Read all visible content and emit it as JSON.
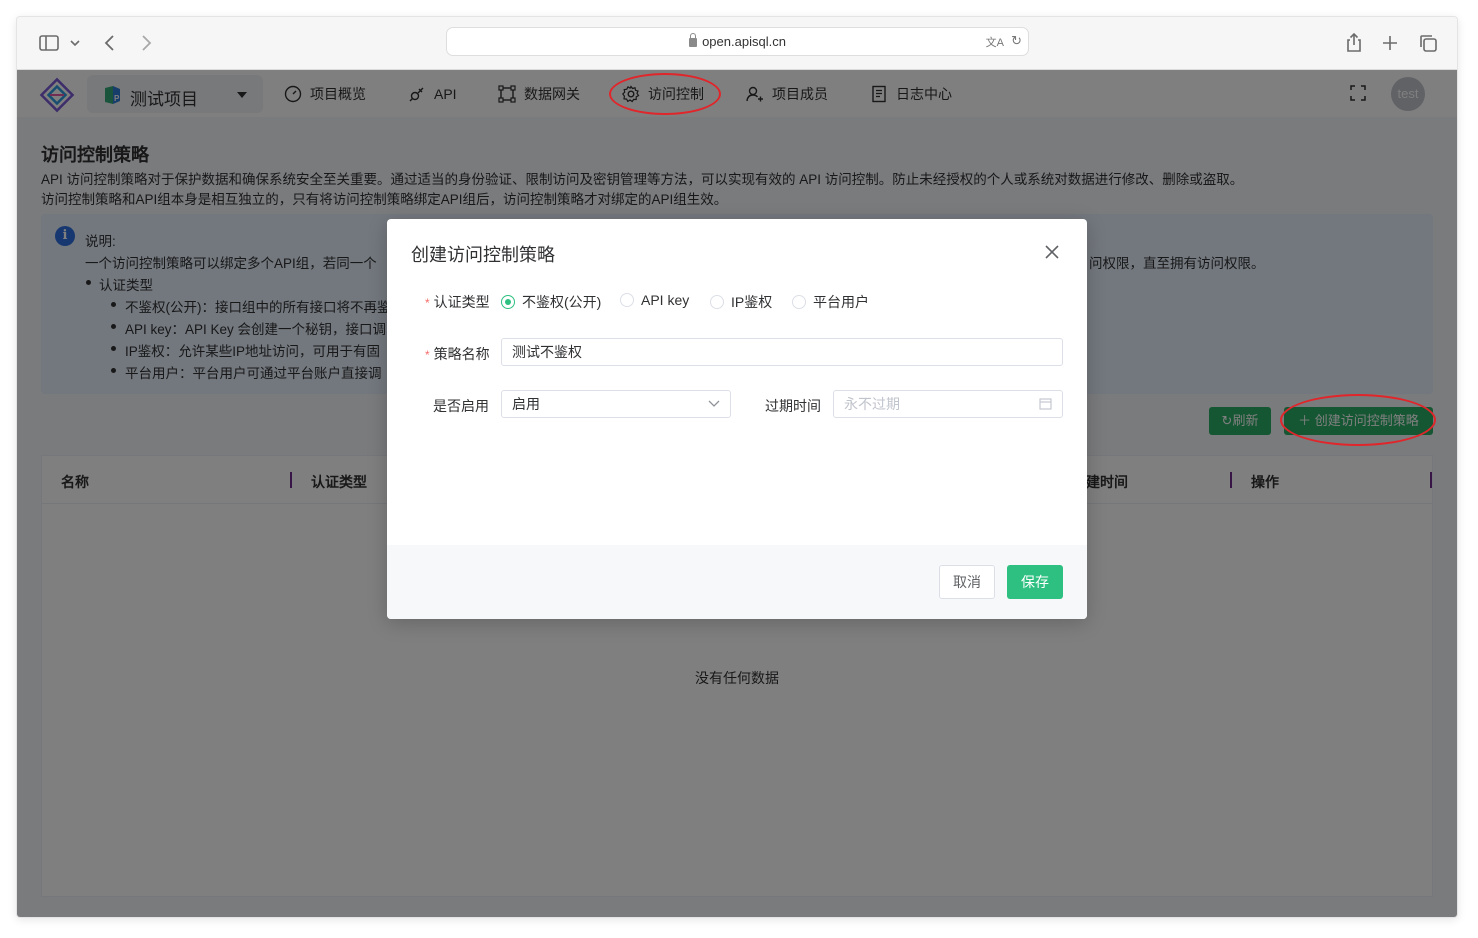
{
  "browser": {
    "url": "open.apisql.cn"
  },
  "app": {
    "project_name": "测试项目",
    "nav": [
      {
        "label": "项目概览"
      },
      {
        "label": "API"
      },
      {
        "label": "数据网关"
      },
      {
        "label": "访问控制"
      },
      {
        "label": "项目成员"
      },
      {
        "label": "日志中心"
      }
    ],
    "avatar_text": "test",
    "accent": "#2dc081"
  },
  "page": {
    "title": "访问控制策略",
    "desc_1": "API 访问控制策略对于保护数据和确保系统安全至关重要。通过适当的身份验证、限制访问及密钥管理等方法，可以实现有效的 API 访问控制。防止未经授权的个人或系统对数据进行修改、删除或盗取。",
    "desc_2": "访问控制策略和API组本身是相互独立的，只有将访问控制策略绑定API组后，访问控制策略才对绑定的API组生效。",
    "info": {
      "heading": "说明:",
      "line1_left": "一个访问控制策略可以绑定多个API组，若同一个",
      "line1_right": "问权限，直至拥有访问权限。",
      "auth_types_title": "认证类型",
      "items": [
        "不鉴权(公开)：接口组中的所有接口将不再鉴",
        "API key：API Key 会创建一个秘钥，接口调",
        "IP鉴权：允许某些IP地址访问，可用于有固",
        "平台用户：平台用户可通过平台账户直接调"
      ]
    },
    "refresh_label": "刷新",
    "create_label": "创建访问控制策略",
    "table": {
      "columns": [
        "名称",
        "认证类型",
        "建时间",
        "操作"
      ],
      "empty_text": "没有任何数据"
    }
  },
  "dialog": {
    "title": "创建访问控制策略",
    "auth_type_label": "认证类型",
    "auth_options": [
      "不鉴权(公开)",
      "API key",
      "IP鉴权",
      "平台用户"
    ],
    "auth_selected": "不鉴权(公开)",
    "policy_name_label": "策略名称",
    "policy_name_value": "测试不鉴权",
    "enabled_label": "是否启用",
    "enabled_value": "启用",
    "expire_label": "过期时间",
    "expire_placeholder": "永不过期",
    "cancel_label": "取消",
    "save_label": "保存"
  }
}
